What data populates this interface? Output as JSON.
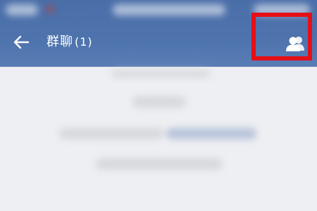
{
  "header": {
    "title": "群聊",
    "member_count": "(1)",
    "back_icon": "arrow-left-icon",
    "members_icon": "group-members-icon",
    "background_color": "#4e73ad"
  },
  "annotation": {
    "highlight_color": "#e60f17"
  }
}
